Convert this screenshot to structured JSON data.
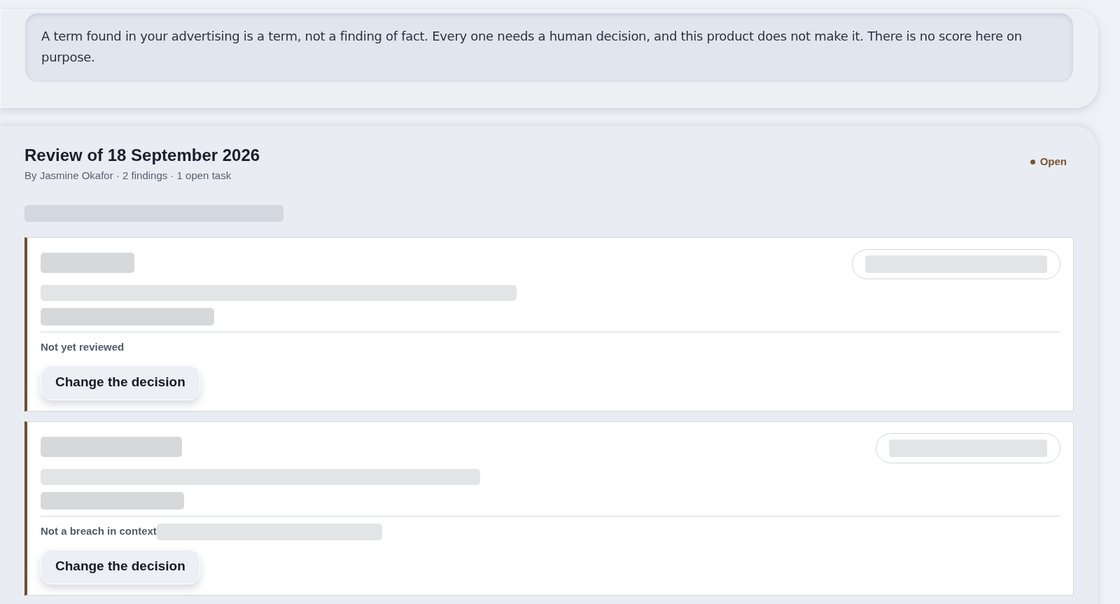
{
  "notice": "A term found in your advertising is a term, not a finding of fact. Every one needs a human decision, and this product does not make it. There is no score here on purpose.",
  "review": {
    "title": "Review of 18 September 2026",
    "meta": "By Jasmine Okafor · 2 findings · 1 open task",
    "status": {
      "label": "Open",
      "color": "#7a5530"
    },
    "findings": [
      {
        "decision": "Not yet reviewed",
        "decision_note": false,
        "button": "Change the decision"
      },
      {
        "decision": "Not a breach in context",
        "decision_note": true,
        "button": "Change the decision"
      }
    ]
  }
}
